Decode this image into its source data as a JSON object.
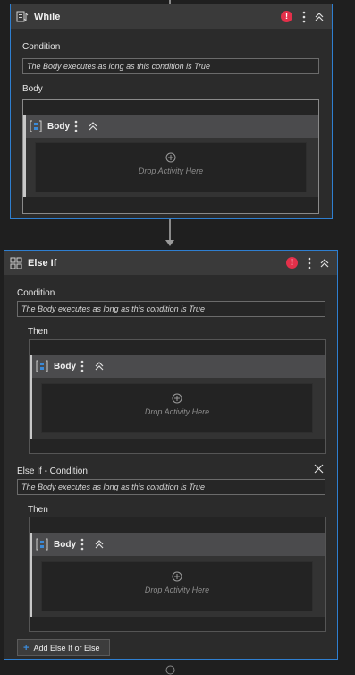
{
  "while_block": {
    "title": "While",
    "condition_label": "Condition",
    "condition_value": "The Body executes as long as this condition is True",
    "body_label": "Body",
    "body_card": {
      "title": "Body",
      "drop_text": "Drop Activity Here"
    }
  },
  "else_if_block": {
    "title": "Else If",
    "condition_label": "Condition",
    "condition_value": "The Body executes as long as this condition is True",
    "then_label": "Then",
    "then_body": {
      "title": "Body",
      "drop_text": "Drop Activity Here"
    },
    "else_if_condition_label": "Else If - Condition",
    "else_if_condition_value": "The Body executes as long as this condition is True",
    "then2_label": "Then",
    "then2_body": {
      "title": "Body",
      "drop_text": "Drop Activity Here"
    },
    "add_button_label": "Add Else If or Else"
  },
  "colors": {
    "accent": "#2f7fd0",
    "error": "#e3304a",
    "background": "#1f1f1f"
  }
}
